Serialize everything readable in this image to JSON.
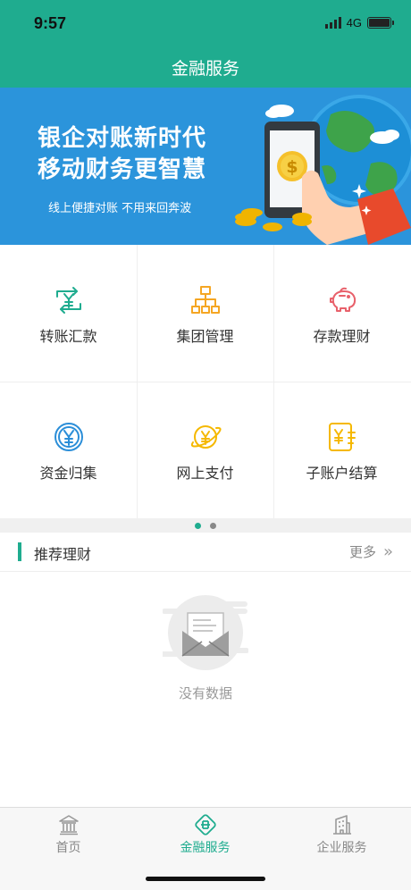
{
  "status_bar": {
    "time": "9:57",
    "network": "4G"
  },
  "nav": {
    "title": "金融服务"
  },
  "banner": {
    "headline_line1": "银企对账新时代",
    "headline_line2": "移动财务更智慧",
    "subtitle": "线上便捷对账 不用来回奔波"
  },
  "services": [
    {
      "label": "转账汇款",
      "icon": "transfer-icon",
      "color": "#1fac8f"
    },
    {
      "label": "集团管理",
      "icon": "org-chart-icon",
      "color": "#f5a623"
    },
    {
      "label": "存款理财",
      "icon": "piggy-bank-icon",
      "color": "#e8616b"
    },
    {
      "label": "资金归集",
      "icon": "yen-coin-icon",
      "color": "#2b8ed8"
    },
    {
      "label": "网上支付",
      "icon": "online-payment-icon",
      "color": "#f5b800"
    },
    {
      "label": "子账户结算",
      "icon": "sub-account-icon",
      "color": "#f5b800"
    }
  ],
  "pager": {
    "page_count": 2,
    "active_index": 0
  },
  "recommend": {
    "title": "推荐理财",
    "more_label": "更多"
  },
  "empty_state": {
    "text": "没有数据"
  },
  "tabs": [
    {
      "label": "首页",
      "icon": "bank-building-icon",
      "active": false
    },
    {
      "label": "金融服务",
      "icon": "finance-icon",
      "active": true
    },
    {
      "label": "企业服务",
      "icon": "office-building-icon",
      "active": false
    }
  ],
  "colors": {
    "brand": "#1fac8f",
    "banner_bg": "#2b94db"
  }
}
